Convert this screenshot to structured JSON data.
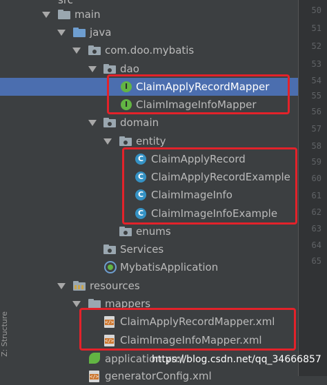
{
  "tree": {
    "partial_top_label": "src",
    "main": "main",
    "java": "java",
    "package": "com.doo.mybatis",
    "dao": "dao",
    "mapper1": "ClaimApplyRecordMapper",
    "mapper2": "ClaimImageInfoMapper",
    "domain": "domain",
    "entity": "entity",
    "entity1": "ClaimApplyRecord",
    "entity2": "ClaimApplyRecordExample",
    "entity3": "ClaimImageInfo",
    "entity4": "ClaimImageInfoExample",
    "enums": "enums",
    "services": "Services",
    "app": "MybatisApplication",
    "resources": "resources",
    "mappers": "mappers",
    "xml1": "ClaimApplyRecordMapper.xml",
    "xml2": "ClaimImageInfoMapper.xml",
    "appyml": "application.yml",
    "genconfig": "generatorConfig.xml"
  },
  "gutter": [
    "50",
    "51",
    "52",
    "53",
    "54",
    "55",
    "56",
    "57",
    "58",
    "59",
    "60",
    "61",
    "62",
    "63",
    "64",
    "65"
  ],
  "side_tab": "Z: Structure",
  "watermark": "https://blog.csdn.net/qq_34666857",
  "colors": {
    "selection": "#4b6eaf",
    "highlight_box": "#e3222a",
    "interface_icon": "#62b543",
    "class_icon": "#3592c4"
  }
}
